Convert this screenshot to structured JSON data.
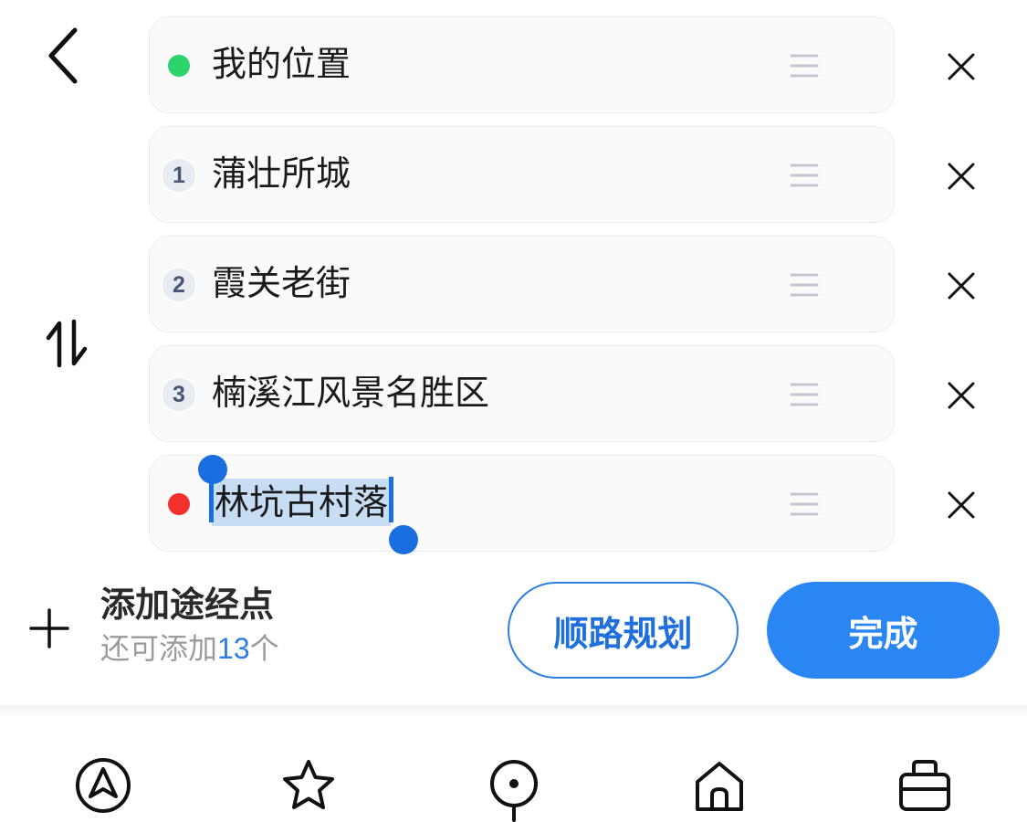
{
  "route": {
    "waypoints": [
      {
        "marker_type": "start-dot",
        "label": "我的位置",
        "color": "#2bd46a"
      },
      {
        "marker_type": "number",
        "marker": "1",
        "label": "蒲壮所城"
      },
      {
        "marker_type": "number",
        "marker": "2",
        "label": "霞关老街"
      },
      {
        "marker_type": "number",
        "marker": "3",
        "label": "楠溪江风景名胜区"
      },
      {
        "marker_type": "end-dot",
        "label": "林坑古村落",
        "color": "#f2312d",
        "selected": true
      }
    ],
    "icons": {
      "back": "chevron-left-icon",
      "swap": "swap-arrows-icon",
      "drag": "drag-handle-icon",
      "remove": "close-icon"
    }
  },
  "add_waypoint": {
    "title": "添加途经点",
    "remaining_prefix": "还可添加",
    "remaining_count": "13",
    "remaining_suffix": "个",
    "icon": "plus-icon"
  },
  "buttons": {
    "route_planning": "顺路规划",
    "done": "完成"
  },
  "colors": {
    "accent": "#2a86f2",
    "selection": "#c7ddf4",
    "selection_handle": "#1a6fe0",
    "number_badge_bg": "#e9ebf2",
    "number_badge_text": "#4a5475"
  },
  "bottom_nav": [
    "navigation-icon",
    "star-icon",
    "map-pin-icon",
    "home-icon",
    "briefcase-icon"
  ]
}
